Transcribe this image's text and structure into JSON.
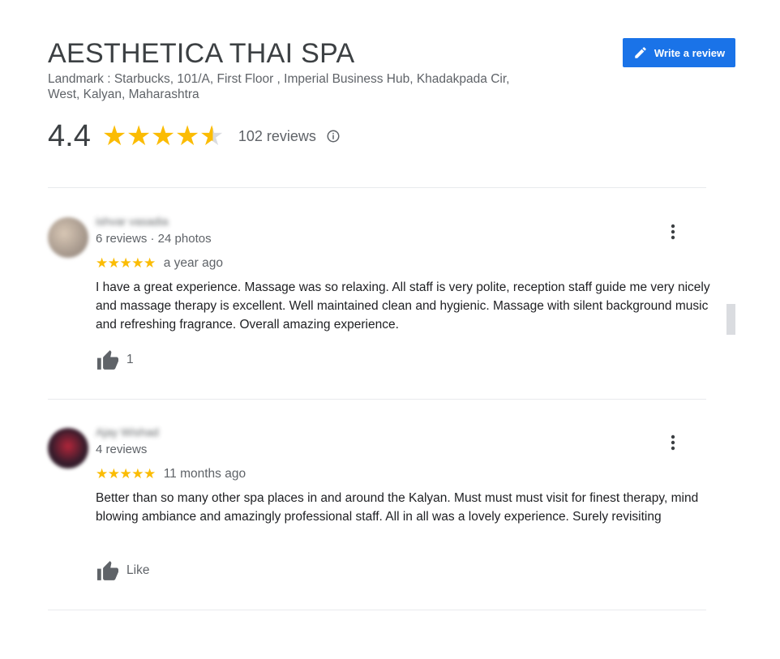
{
  "place": {
    "name": "AESTHETICA THAI SPA",
    "address_line1": "Landmark : Starbucks, 101/A, First Floor , Imperial Business Hub, Khadakpada Cir,",
    "address_line2": "West, Kalyan, Maharashtra",
    "rating": "4.4",
    "rating_value": 4.4,
    "review_count": "102 reviews",
    "star_color": "#fbbc04"
  },
  "actions": {
    "write_review": "Write a review",
    "write_review_icon": "pencil-icon",
    "accent": "#1a73e8"
  },
  "reviews": [
    {
      "name": "ishvar vasadia",
      "meta": "6 reviews · 24 photos",
      "stars": "★★★★★",
      "rating": 5,
      "time": "a year ago",
      "text": "I have a great experience. Massage was so relaxing. All staff is very polite, reception staff guide me very nicely and massage therapy is excellent. Well maintained clean and hygienic. Massage with silent background music and refreshing fragrance. Overall amazing experience.",
      "likes": "1"
    },
    {
      "name": "Ajay Wishad",
      "meta": "4 reviews",
      "stars": "★★★★★",
      "rating": 5,
      "time": "11 months ago",
      "text": "Better than so many other spa places in and around the Kalyan. Must must must visit for finest therapy, mind blowing ambiance and amazingly professional staff. All in all was a lovely experience. Surely revisiting",
      "likes": "Like"
    }
  ]
}
